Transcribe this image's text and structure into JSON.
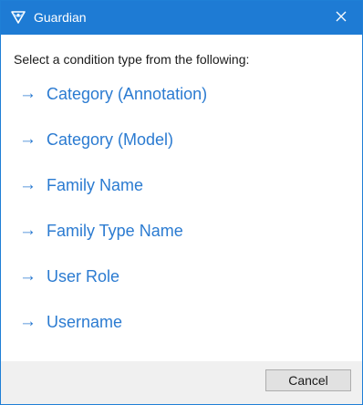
{
  "window": {
    "title": "Guardian",
    "app_icon": "guardian-logo-icon",
    "close_icon": "close-icon",
    "accent_color": "#1e7bd4"
  },
  "content": {
    "prompt": "Select a condition type from the following:",
    "link_color": "#2b7bd1",
    "arrow_icon": "arrow-right-icon",
    "arrow_glyph": "→",
    "options": [
      {
        "label": "Category (Annotation)"
      },
      {
        "label": "Category (Model)"
      },
      {
        "label": "Family Name"
      },
      {
        "label": "Family Type Name"
      },
      {
        "label": "User Role"
      },
      {
        "label": "Username"
      }
    ]
  },
  "footer": {
    "cancel_label": "Cancel"
  }
}
